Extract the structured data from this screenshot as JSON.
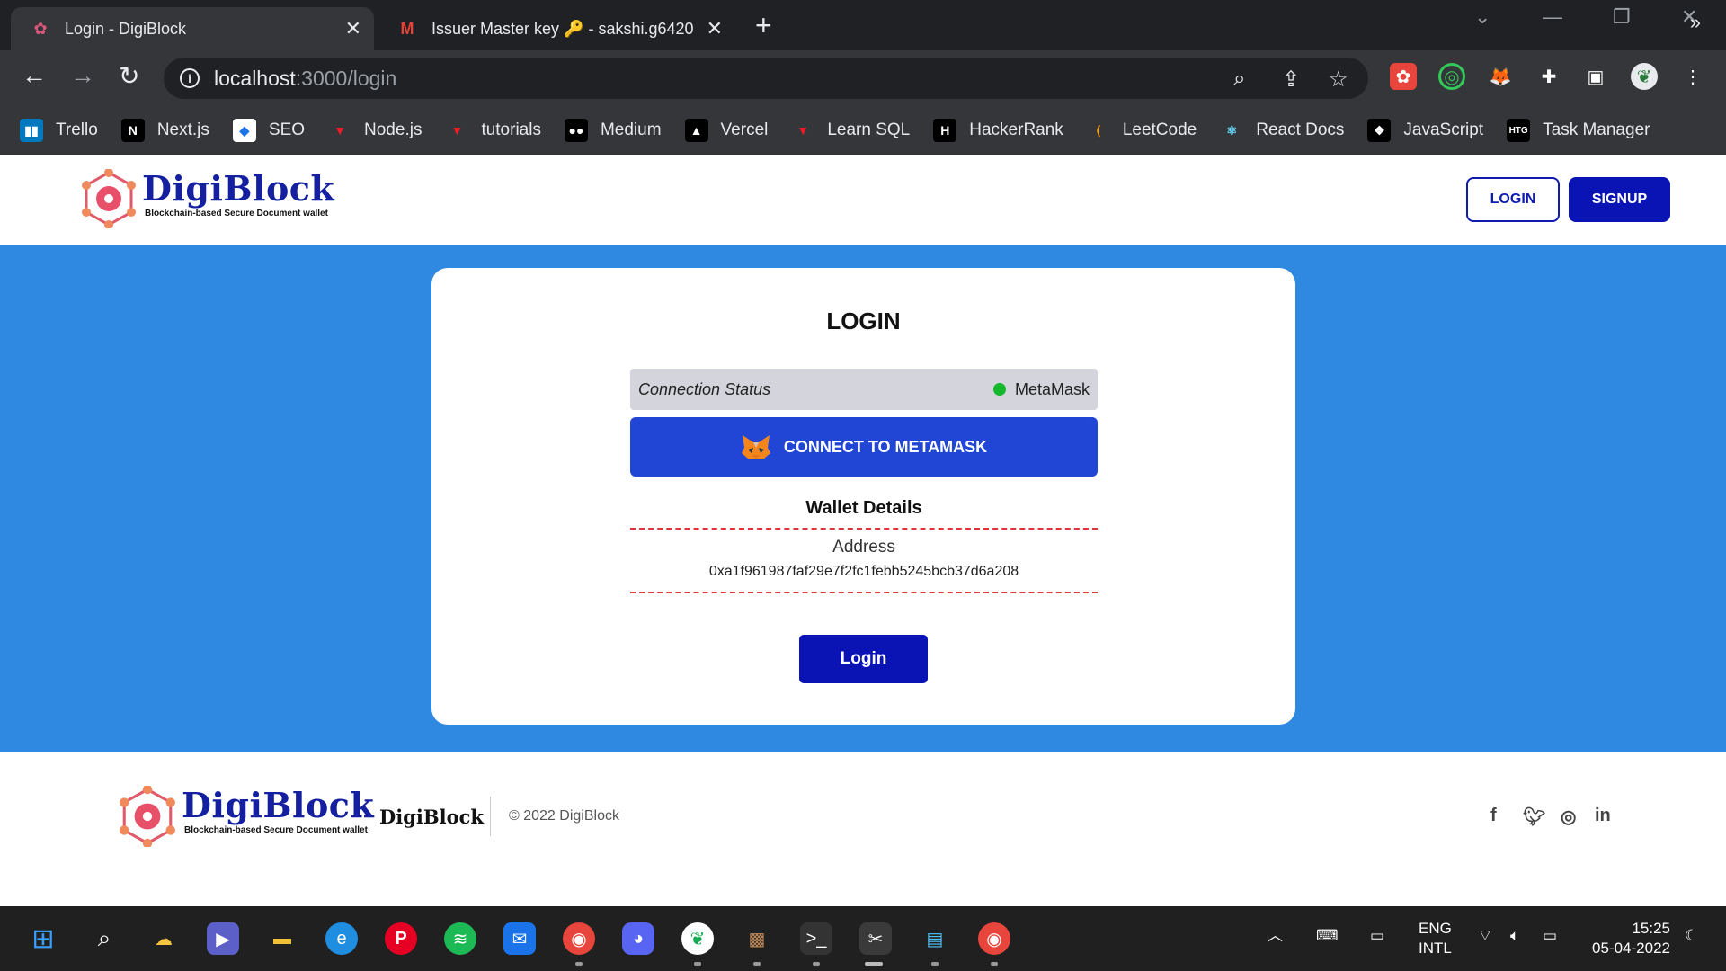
{
  "browser": {
    "tabs": [
      {
        "title": "Login - DigiBlock",
        "active": true
      },
      {
        "title": "Issuer Master key 🔑 - sakshi.g6420",
        "active": false
      }
    ],
    "url_host": "localhost",
    "url_rest": ":3000/login",
    "bookmarks": [
      {
        "label": "Trello",
        "icon": "trello-icon",
        "color": "#0079bf",
        "glyph": "▮▮"
      },
      {
        "label": "Next.js",
        "icon": "nextjs-icon",
        "color": "#000000",
        "glyph": "N"
      },
      {
        "label": "SEO",
        "icon": "seo-icon",
        "color": "#ffffff",
        "glyph": "◆"
      },
      {
        "label": "Node.js",
        "icon": "nodejs-icon",
        "color": "#ee1c25",
        "glyph": "▼"
      },
      {
        "label": "tutorials",
        "icon": "tutorials-icon",
        "color": "#ee1c25",
        "glyph": "▼"
      },
      {
        "label": "Medium",
        "icon": "medium-icon",
        "color": "#000000",
        "glyph": "●●"
      },
      {
        "label": "Vercel",
        "icon": "vercel-icon",
        "color": "#000000",
        "glyph": "▲"
      },
      {
        "label": "Learn SQL",
        "icon": "learn-sql-icon",
        "color": "#ee1c25",
        "glyph": "▼"
      },
      {
        "label": "HackerRank",
        "icon": "hackerrank-icon",
        "color": "#000000",
        "glyph": "H"
      },
      {
        "label": "LeetCode",
        "icon": "leetcode-icon",
        "color": "#35363a",
        "glyph": "⟨"
      },
      {
        "label": "React Docs",
        "icon": "react-icon",
        "color": "#35363a",
        "glyph": "⚛"
      },
      {
        "label": "JavaScript",
        "icon": "javascript-icon",
        "color": "#000000",
        "glyph": "❖"
      },
      {
        "label": "Task Manager",
        "icon": "task-manager-icon",
        "color": "#000000",
        "glyph": "HTG"
      }
    ]
  },
  "header": {
    "logo_title": "DigiBlock",
    "logo_subtitle": "Blockchain-based Secure Document wallet",
    "login_label": "LOGIN",
    "signup_label": "SIGNUP"
  },
  "card": {
    "title": "LOGIN",
    "status_label": "Connection Status",
    "status_value": "MetaMask",
    "connect_label": "CONNECT TO METAMASK",
    "wallet_title": "Wallet Details",
    "address_label": "Address",
    "address_value": "0xa1f961987faf29e7f2fc1febb5245bcb37d6a208",
    "login_button": "Login"
  },
  "footer": {
    "logo_title": "DigiBlock",
    "logo_subtitle": "Blockchain-based Secure Document wallet",
    "brand": "DigiBlock",
    "copyright": "© 2022 DigiBlock"
  },
  "taskbar": {
    "lang": "ENG",
    "layout": "INTL",
    "time": "15:25",
    "date": "05-04-2022"
  },
  "colors": {
    "brand_blue": "#0a14b5",
    "page_blue": "#3089e0",
    "connect_blue": "#2146d6",
    "status_green": "#13b82c",
    "dash_red": "#e0333a"
  }
}
